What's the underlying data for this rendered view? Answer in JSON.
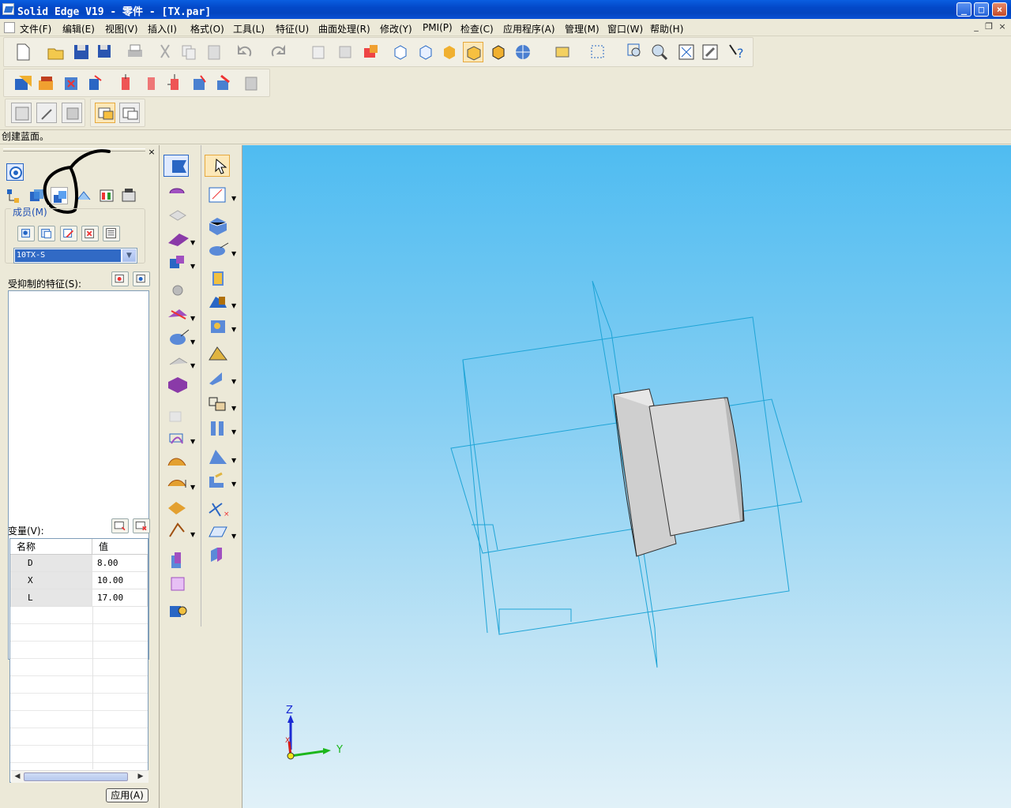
{
  "window": {
    "title": "Solid Edge V19 - 零件 - [TX.par]",
    "min": "_",
    "max": "□",
    "close": "×"
  },
  "menu": {
    "items": [
      "文件(F)",
      "编辑(E)",
      "视图(V)",
      "插入(I)",
      "格式(O)",
      "工具(L)",
      "特征(U)",
      "曲面处理(R)",
      "修改(Y)",
      "PMI(P)",
      "检查(C)",
      "应用程序(A)",
      "管理(M)",
      "窗口(W)",
      "帮助(H)"
    ]
  },
  "status": {
    "text": "创建蓝面。"
  },
  "panel": {
    "close": "×",
    "members_label": "成员(M)",
    "combo_value": "10TX-S",
    "suppressed_label": "受抑制的特征(S):",
    "variables_label": "变量(V):",
    "col_name": "名称",
    "col_value": "值",
    "rows": [
      {
        "name": "D",
        "value": "8.00"
      },
      {
        "name": "X",
        "value": "10.00"
      },
      {
        "name": "L",
        "value": "17.00"
      }
    ],
    "apply_label": "应用(A)"
  },
  "triad": {
    "z": "Z",
    "y": "Y",
    "x": "X"
  },
  "colors": {
    "title_bar": "#0348c8",
    "viewport_top": "#4fbcf1",
    "viewport_bottom": "#e1f1f8",
    "sketch_plane": "#1fa4d6",
    "part_gray": "#c8c8c8",
    "annotation": "#000000"
  }
}
